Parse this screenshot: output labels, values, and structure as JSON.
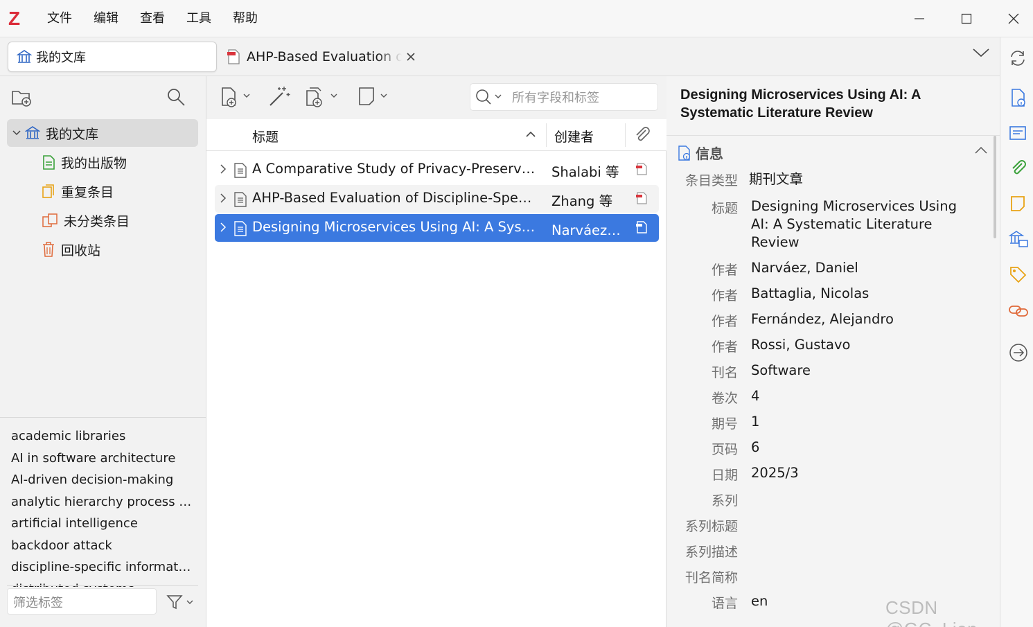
{
  "app": {
    "logo": "Z",
    "menu": [
      "文件",
      "编辑",
      "查看",
      "工具",
      "帮助"
    ]
  },
  "tabs": {
    "library_tab": "我的文库",
    "doc_tab": "AHP-Based Evaluation of Discipline-Specific"
  },
  "collections": [
    {
      "label": "我的文库",
      "icon": "library-icon",
      "selected": true
    },
    {
      "label": "我的出版物",
      "icon": "publications-icon"
    },
    {
      "label": "重复条目",
      "icon": "duplicates-icon"
    },
    {
      "label": "未分类条目",
      "icon": "unfiled-icon"
    },
    {
      "label": "回收站",
      "icon": "trash-icon"
    }
  ],
  "tags": [
    "academic libraries",
    "AI in software architecture",
    "AI-driven decision-making",
    "analytic hierarchy process (AHP)",
    "artificial intelligence",
    "backdoor attack",
    "discipline-specific information services",
    "distributed systems"
  ],
  "tag_filter": {
    "placeholder": "筛选标签"
  },
  "search": {
    "placeholder": "所有字段和标签"
  },
  "columns": {
    "title": "标题",
    "creator": "创建者"
  },
  "items": [
    {
      "title": "A Comparative Study of Privacy-Preserving Federated Learning",
      "creator": "Shalabi 等",
      "selected": false
    },
    {
      "title": "AHP-Based Evaluation of Discipline-Specific Information Services",
      "creator": "Zhang 等",
      "selected": false
    },
    {
      "title": "Designing Microservices Using AI: A Systematic Literature Review",
      "creator": "Narváez 等",
      "selected": true
    }
  ],
  "info": {
    "header_title": "Designing Microservices Using AI: A Systematic Literature Review",
    "section_label": "信息",
    "fields": [
      {
        "label": "条目类型",
        "value": "期刊文章"
      },
      {
        "label": "标题",
        "value": "Designing Microservices Using AI: A Systematic Literature Review"
      },
      {
        "label": "作者",
        "value": "Narváez, Daniel"
      },
      {
        "label": "作者",
        "value": "Battaglia, Nicolas"
      },
      {
        "label": "作者",
        "value": "Fernández, Alejandro"
      },
      {
        "label": "作者",
        "value": "Rossi, Gustavo"
      },
      {
        "label": "刊名",
        "value": "Software"
      },
      {
        "label": "卷次",
        "value": "4"
      },
      {
        "label": "期号",
        "value": "1"
      },
      {
        "label": "页码",
        "value": "6"
      },
      {
        "label": "日期",
        "value": "2025/3"
      },
      {
        "label": "系列",
        "value": ""
      },
      {
        "label": "系列标题",
        "value": ""
      },
      {
        "label": "系列描述",
        "value": ""
      },
      {
        "label": "刊名简称",
        "value": ""
      },
      {
        "label": "语言",
        "value": "en"
      }
    ]
  },
  "watermark": "CSDN @GC_Lion",
  "colors": {
    "accent": "#3b79e0",
    "brand": "#db2c3a",
    "selected_tree": "#dcdcdc"
  }
}
